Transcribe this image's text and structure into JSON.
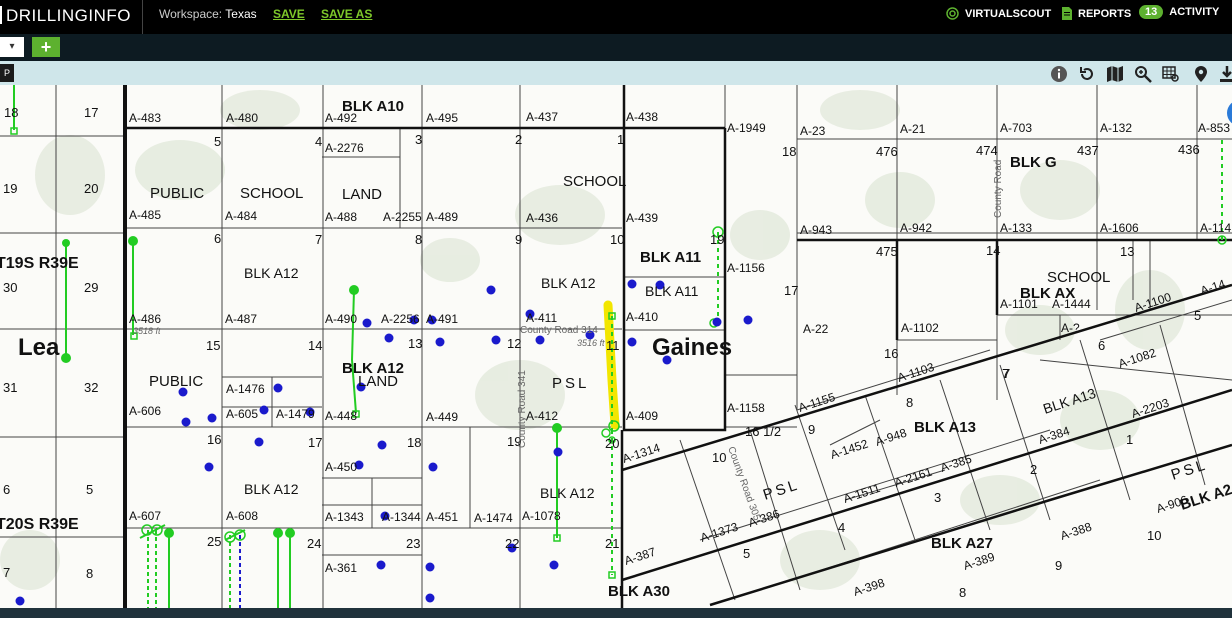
{
  "header": {
    "brand": "DRILLINGINFO",
    "workspace_label": "Workspace:",
    "workspace_value": "Texas",
    "save": "SAVE",
    "save_as": "SAVE AS",
    "virtualscout": "VIRTUALSCOUT",
    "reports": "REPORTS",
    "activity_count": "13",
    "activity": "ACTIVITY"
  },
  "colors": {
    "brand_green": "#5db12f",
    "link_green": "#7ec82a",
    "well_green": "#22cc22",
    "well_blue": "#1a1acc",
    "highlight": "#f2e600"
  },
  "tabs": {
    "add_label": "+"
  },
  "toolbar": {
    "icons": [
      "info-icon",
      "undo-icon",
      "map-icon",
      "zoom-icon",
      "grid-icon",
      "pin-icon",
      "download-icon"
    ]
  },
  "map": {
    "county_labels": [
      "Lea",
      "Gaines"
    ],
    "township_labels": [
      "T19S R39E",
      "T20S R39E"
    ],
    "block_labels": [
      "BLK A10",
      "BLK A11",
      "BLK A11",
      "BLK A12",
      "BLK A12",
      "BLK A12",
      "BLK A12",
      "BLK A12",
      "BLK G",
      "BLK AX",
      "BLK A13",
      "BLK A13",
      "BLK A27",
      "BLK A30",
      "BLK A2"
    ],
    "land_labels": [
      "PUBLIC",
      "SCHOOL",
      "LAND",
      "SCHOOL",
      "PUBLIC",
      "LAND",
      "PSL",
      "SCHOOL",
      "PSL",
      "PSL"
    ],
    "abstracts": [
      "A-483",
      "A-480",
      "A-492",
      "A-495",
      "A-437",
      "A-438",
      "A-1949",
      "A-23",
      "A-21",
      "A-703",
      "A-132",
      "A-853",
      "A-2276",
      "A-485",
      "A-484",
      "A-488",
      "A-2255",
      "A-489",
      "A-436",
      "A-439",
      "A-943",
      "A-942",
      "A-133",
      "A-1606",
      "A-1156",
      "A-486",
      "A-487",
      "A-490",
      "A-2256",
      "A-491",
      "A-411",
      "A-410",
      "A-22",
      "A-1102",
      "A-1101",
      "A-1444",
      "A-1100",
      "A-1476",
      "A-606",
      "A-605",
      "A-1479",
      "A-448",
      "A-449",
      "A-412",
      "A-409",
      "A-1158",
      "A-1155",
      "A-1103",
      "A-1082",
      "A-2203",
      "A-1452",
      "A-948",
      "A-385",
      "A-384",
      "A-450",
      "A-1314",
      "A-1511",
      "A-2161",
      "A-607",
      "A-608",
      "A-1343",
      "A-1344",
      "A-451",
      "A-1474",
      "A-1078",
      "A-1373",
      "A-386",
      "A-388",
      "A-906",
      "A-361",
      "A-387",
      "A-389",
      "A-398",
      "A-?",
      "A-114",
      "A-14"
    ],
    "section_numbers": [
      "18",
      "17",
      "5",
      "4",
      "3",
      "2",
      "1",
      "18",
      "476",
      "474",
      "437",
      "436",
      "19",
      "20",
      "6",
      "7",
      "8",
      "9",
      "10",
      "19",
      "475",
      "14",
      "13",
      "30",
      "29",
      "17",
      "16",
      "15",
      "14",
      "13",
      "12",
      "11",
      "31",
      "32",
      "16",
      "17",
      "18",
      "19",
      "20",
      "16 1/2",
      "9",
      "8",
      "7",
      "6",
      "5",
      "6",
      "5",
      "25",
      "24",
      "23",
      "22",
      "21",
      "10",
      "2",
      "1",
      "7",
      "8",
      "4",
      "3",
      "9",
      "10",
      "5",
      "8",
      "7"
    ],
    "road_labels": [
      "County Road 314",
      "County Road 341",
      "County Road 305",
      "County Road"
    ],
    "elevations": [
      "3516 ft",
      "3518 ft"
    ]
  }
}
